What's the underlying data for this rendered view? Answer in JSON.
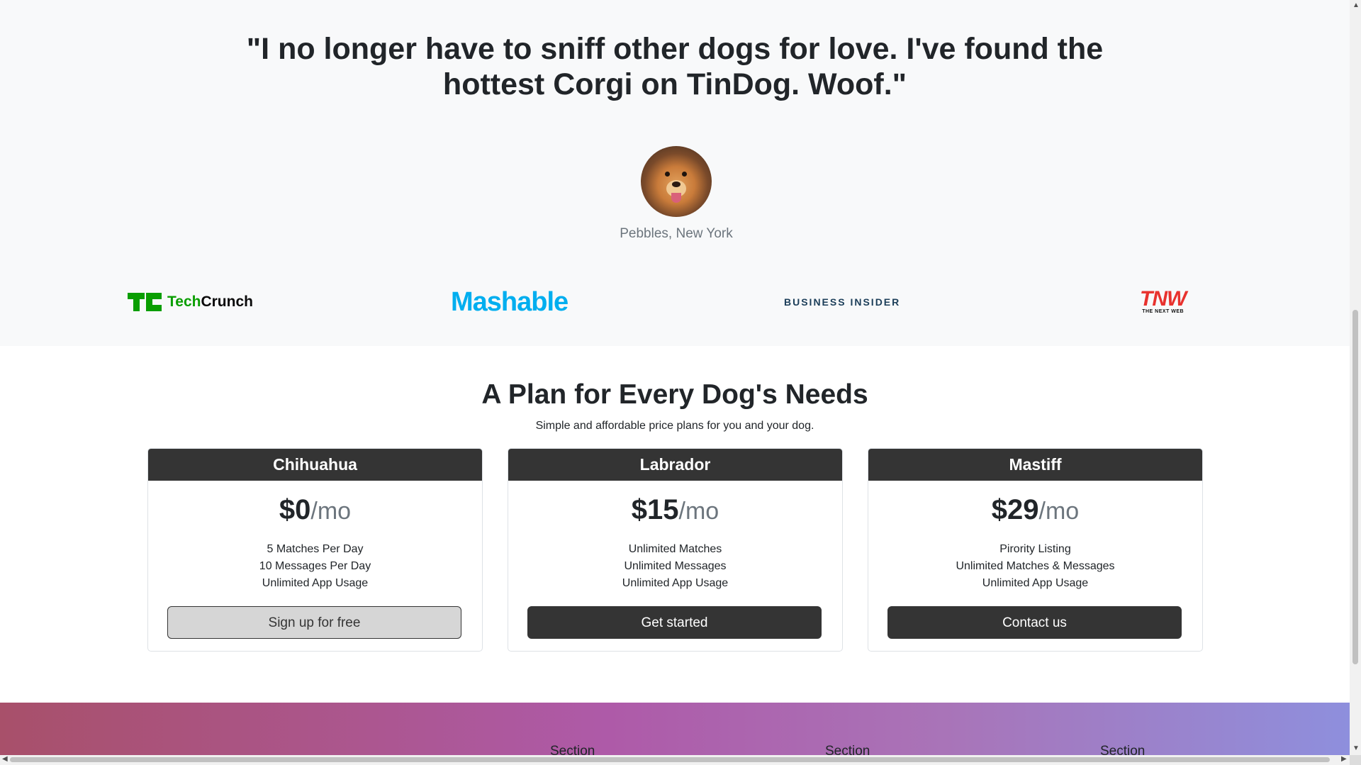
{
  "testimonial": {
    "quote": "\"I no longer have to sniff other dogs for love. I've found the hottest Corgi on TinDog. Woof.\"",
    "author": "Pebbles, New York",
    "avatar_icon": "dog-avatar-icon"
  },
  "press": {
    "logos": [
      {
        "name": "TechCrunch",
        "tech": "Tech",
        "crunch": "Crunch",
        "color": "#0a9e01"
      },
      {
        "name": "Mashable",
        "color": "#00aeef"
      },
      {
        "name": "BUSINESS INSIDER",
        "color": "#1c3e59"
      },
      {
        "name": "TNW",
        "sub": "THE NEXT WEB",
        "color": "#e8322e"
      }
    ]
  },
  "pricing": {
    "title": "A Plan for Every Dog's Needs",
    "subtitle": "Simple and affordable price plans for you and your dog.",
    "per": "/mo",
    "plans": [
      {
        "name": "Chihuahua",
        "price": "$0",
        "features": [
          "5 Matches Per Day",
          "10 Messages Per Day",
          "Unlimited App Usage"
        ],
        "button": "Sign up for free"
      },
      {
        "name": "Labrador",
        "price": "$15",
        "features": [
          "Unlimited Matches",
          "Unlimited Messages",
          "Unlimited App Usage"
        ],
        "button": "Get started"
      },
      {
        "name": "Mastiff",
        "price": "$29",
        "features": [
          "Pirority Listing",
          "Unlimited Matches & Messages",
          "Unlimited App Usage"
        ],
        "button": "Contact us"
      }
    ],
    "header_color": "#343434"
  },
  "footer": {
    "sections": [
      "Section",
      "Section",
      "Section"
    ],
    "gradient_colors": [
      "#a8506a",
      "#ae5aa8",
      "#8e8fdd"
    ]
  }
}
